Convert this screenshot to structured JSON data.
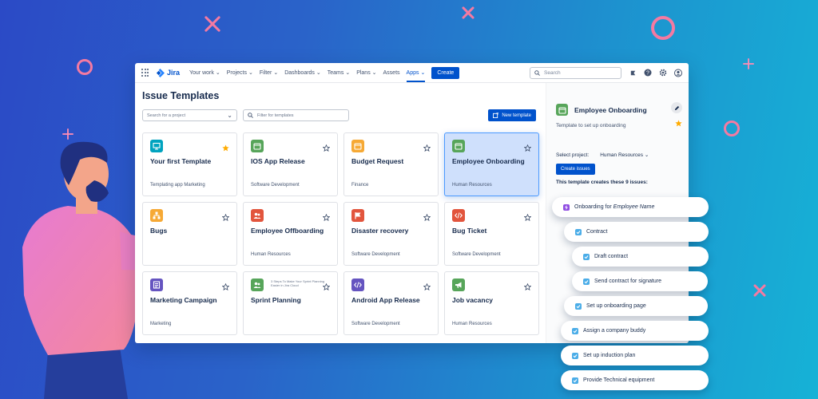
{
  "topbar": {
    "logo": "Jira",
    "nav": [
      "Your work",
      "Projects",
      "Filter",
      "Dashboards",
      "Teams",
      "Plans",
      "Assets",
      "Apps"
    ],
    "nav_dropdown": [
      true,
      true,
      true,
      true,
      true,
      true,
      false,
      true
    ],
    "active_nav": "Apps",
    "create_label": "Create",
    "search_placeholder": "Search"
  },
  "main": {
    "title": "Issue Templates",
    "project_select_placeholder": "Search for a project",
    "filter_placeholder": "Filter for templates",
    "new_template_label": "New template"
  },
  "cards": [
    {
      "title": "Your first Template",
      "category": "Templating app Marketing",
      "icon": "monitor-icon",
      "color": "#00a3bf",
      "starred": true,
      "selected": false
    },
    {
      "title": "IOS App Release",
      "category": "Software Development",
      "icon": "calendar-icon",
      "color": "#57a55a",
      "starred": false,
      "selected": false
    },
    {
      "title": "Budget Request",
      "category": "Finance",
      "icon": "calendar-icon",
      "color": "#f6a935",
      "starred": false,
      "selected": false
    },
    {
      "title": "Employee Onboarding",
      "category": "Human Resources",
      "icon": "calendar-icon",
      "color": "#57a55a",
      "starred": false,
      "selected": true
    },
    {
      "title": "Bugs",
      "category": "",
      "icon": "hierarchy-icon",
      "color": "#f6a935",
      "starred": false,
      "selected": false
    },
    {
      "title": "Employee Offboarding",
      "category": "Human Resources",
      "icon": "people-icon",
      "color": "#e2553d",
      "starred": false,
      "selected": false
    },
    {
      "title": "Disaster recovery",
      "category": "Software Development",
      "icon": "flag-icon",
      "color": "#e2553d",
      "starred": false,
      "selected": false
    },
    {
      "title": "Bug Ticket",
      "category": "Software Development",
      "icon": "code-icon",
      "color": "#e2553d",
      "starred": false,
      "selected": false
    },
    {
      "title": "Marketing Campaign",
      "category": "Marketing",
      "icon": "document-icon",
      "color": "#6554c0",
      "starred": false,
      "selected": false
    },
    {
      "title": "Sprint Planning",
      "category": "",
      "icon": "people-icon",
      "color": "#57a55a",
      "starred": false,
      "selected": false,
      "note": "3 Steps To Make Your Sprint Planning Easier in Jira Cloud"
    },
    {
      "title": "Android App Release",
      "category": "Software Development",
      "icon": "code-icon",
      "color": "#6554c0",
      "starred": false,
      "selected": false
    },
    {
      "title": "Job vacancy",
      "category": "Human Resources",
      "icon": "megaphone-icon",
      "color": "#57a55a",
      "starred": false,
      "selected": false
    }
  ],
  "side": {
    "title": "Employee Onboarding",
    "description": "Template to set up onboarding",
    "project_label": "Select project:",
    "project_value": "Human Resources",
    "create_issues_label": "Create issues",
    "creates_text": "This template creates these 9 issues:"
  },
  "issues": [
    {
      "prefix": "Onboarding for ",
      "emphasis": "Employee Name",
      "type": "epic"
    },
    {
      "prefix": "Contract",
      "emphasis": "",
      "type": "task"
    },
    {
      "prefix": "Draft contract",
      "emphasis": "",
      "type": "subtask"
    },
    {
      "prefix": "Send contract for signature",
      "emphasis": "",
      "type": "subtask"
    },
    {
      "prefix": "Set up onboarding page",
      "emphasis": "",
      "type": "task"
    },
    {
      "prefix": "Assign a company buddy",
      "emphasis": "",
      "type": "task"
    },
    {
      "prefix": "Set up induction plan",
      "emphasis": "",
      "type": "task"
    },
    {
      "prefix": "Provide Technical equipment",
      "emphasis": "",
      "type": "task"
    }
  ]
}
